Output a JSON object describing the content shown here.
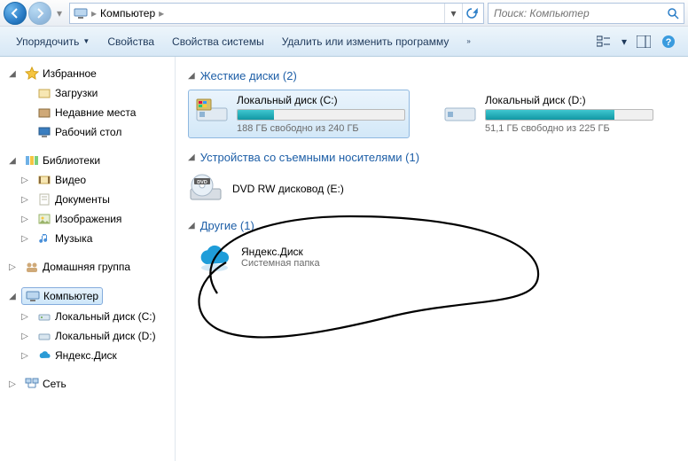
{
  "nav": {
    "breadcrumb_root": "Компьютер",
    "search_placeholder": "Поиск: Компьютер"
  },
  "toolbar": {
    "organize": "Упорядочить",
    "properties": "Свойства",
    "sys_properties": "Свойства системы",
    "uninstall": "Удалить или изменить программу"
  },
  "tree": {
    "favorites": {
      "label": "Избранное",
      "items": [
        "Загрузки",
        "Недавние места",
        "Рабочий стол"
      ]
    },
    "libraries": {
      "label": "Библиотеки",
      "items": [
        "Видео",
        "Документы",
        "Изображения",
        "Музыка"
      ]
    },
    "homegroup": {
      "label": "Домашняя группа"
    },
    "computer": {
      "label": "Компьютер",
      "items": [
        "Локальный диск (C:)",
        "Локальный диск (D:)",
        "Яндекс.Диск"
      ]
    },
    "network": {
      "label": "Сеть"
    }
  },
  "sections": {
    "hdd": {
      "title": "Жесткие диски (2)"
    },
    "removable": {
      "title": "Устройства со съемными носителями (1)"
    },
    "other": {
      "title": "Другие (1)"
    }
  },
  "drives": {
    "c": {
      "name": "Локальный диск (C:)",
      "status": "188 ГБ свободно из 240 ГБ",
      "fill_percent": 22
    },
    "d": {
      "name": "Локальный диск (D:)",
      "status": "51,1 ГБ свободно из 225 ГБ",
      "fill_percent": 77
    }
  },
  "optical": {
    "name": "DVD RW дисковод (E:)"
  },
  "other_item": {
    "name": "Яндекс.Диск",
    "sub": "Системная папка"
  }
}
